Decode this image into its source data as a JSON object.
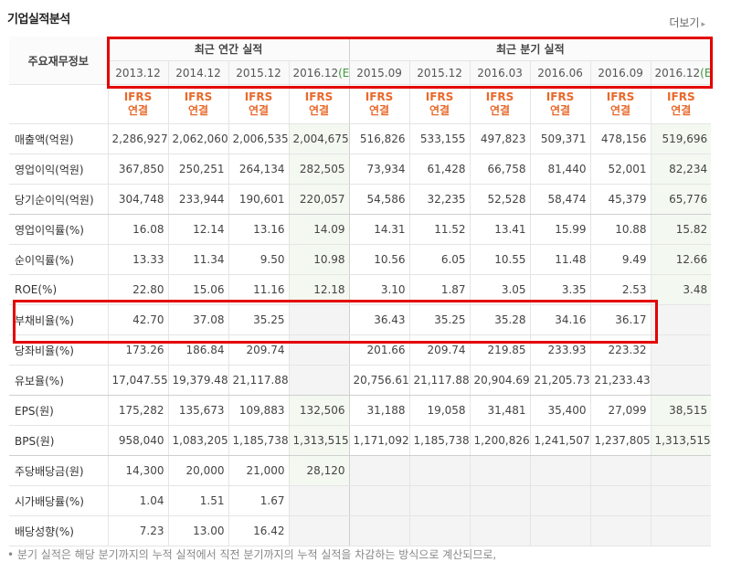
{
  "title": "기업실적분석",
  "more_label": "더보기",
  "header": {
    "row_label": "주요재무정보",
    "annual_group": "최근 연간 실적",
    "quarter_group": "최근 분기 실적",
    "periods": [
      "2013.12",
      "2014.12",
      "2015.12",
      "2016.12",
      "2015.09",
      "2015.12",
      "2016.03",
      "2016.06",
      "2016.09",
      "2016.12"
    ],
    "estimate_suffix": "(E)",
    "ifrs_top": "IFRS",
    "ifrs_bottom": "연결"
  },
  "rows": [
    {
      "label": "매출액(억원)",
      "values": [
        "2,286,927",
        "2,062,060",
        "2,006,535",
        "2,004,675",
        "516,826",
        "533,155",
        "497,823",
        "509,371",
        "478,156",
        "519,696"
      ]
    },
    {
      "label": "영업이익(억원)",
      "values": [
        "367,850",
        "250,251",
        "264,134",
        "282,505",
        "73,934",
        "61,428",
        "66,758",
        "81,440",
        "52,001",
        "82,234"
      ]
    },
    {
      "label": "당기순이익(억원)",
      "values": [
        "304,748",
        "233,944",
        "190,601",
        "220,057",
        "54,586",
        "32,235",
        "52,528",
        "58,474",
        "45,379",
        "65,776"
      ]
    },
    {
      "label": "영업이익률(%)",
      "values": [
        "16.08",
        "12.14",
        "13.16",
        "14.09",
        "14.31",
        "11.52",
        "13.41",
        "15.99",
        "10.88",
        "15.82"
      ]
    },
    {
      "label": "순이익률(%)",
      "values": [
        "13.33",
        "11.34",
        "9.50",
        "10.98",
        "10.56",
        "6.05",
        "10.55",
        "11.48",
        "9.49",
        "12.66"
      ]
    },
    {
      "label": "ROE(%)",
      "values": [
        "22.80",
        "15.06",
        "11.16",
        "12.18",
        "3.10",
        "1.87",
        "3.05",
        "3.35",
        "2.53",
        "3.48"
      ]
    },
    {
      "label": "부채비율(%)",
      "values": [
        "42.70",
        "37.08",
        "35.25",
        "",
        "36.43",
        "35.25",
        "35.28",
        "34.16",
        "36.17",
        ""
      ]
    },
    {
      "label": "당좌비율(%)",
      "values": [
        "173.26",
        "186.84",
        "209.74",
        "",
        "201.66",
        "209.74",
        "219.85",
        "233.93",
        "223.32",
        ""
      ]
    },
    {
      "label": "유보율(%)",
      "values": [
        "17,047.55",
        "19,379.48",
        "21,117.88",
        "",
        "20,756.61",
        "21,117.88",
        "20,904.69",
        "21,205.73",
        "21,233.43",
        ""
      ]
    },
    {
      "label": "EPS(원)",
      "values": [
        "175,282",
        "135,673",
        "109,883",
        "132,506",
        "31,188",
        "19,058",
        "31,481",
        "35,400",
        "27,099",
        "38,515"
      ]
    },
    {
      "label": "BPS(원)",
      "values": [
        "958,040",
        "1,083,205",
        "1,185,738",
        "1,313,515",
        "1,171,092",
        "1,185,738",
        "1,200,826",
        "1,241,507",
        "1,237,805",
        "1,313,515"
      ]
    },
    {
      "label": "주당배당금(원)",
      "values": [
        "14,300",
        "20,000",
        "21,000",
        "28,120",
        "",
        "",
        "",
        "",
        "",
        ""
      ]
    },
    {
      "label": "시가배당률(%)",
      "values": [
        "1.04",
        "1.51",
        "1.67",
        "",
        "",
        "",
        "",
        "",
        "",
        ""
      ]
    },
    {
      "label": "배당성향(%)",
      "values": [
        "7.23",
        "13.00",
        "16.42",
        "",
        "",
        "",
        "",
        "",
        "",
        ""
      ]
    }
  ],
  "footnote": "분기 실적은 해당 분기까지의 누적 실적에서 직전 분기까지의 누적 실적을 차감하는 방식으로 계산되므로,",
  "colors": {
    "highlight": "#e30000",
    "ifrs": "#e8692b",
    "estimate_bg": "#f3f8f0",
    "estimate_mark": "#3c9a3c"
  }
}
